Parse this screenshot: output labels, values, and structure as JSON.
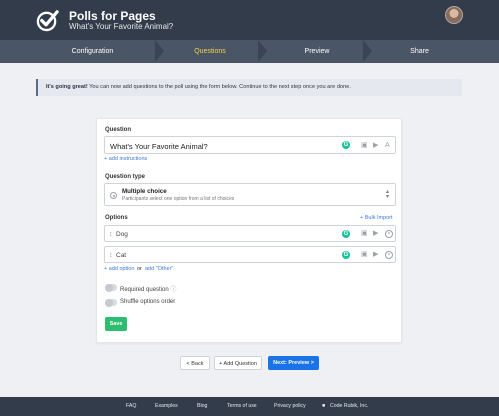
{
  "header": {
    "app_title": "Polls for Pages",
    "app_subtitle": "What's Your Favorite Animal?"
  },
  "steps": [
    {
      "label": "Configuration",
      "active": false
    },
    {
      "label": "Questions",
      "active": true
    },
    {
      "label": "Preview",
      "active": false
    },
    {
      "label": "Share",
      "active": false
    }
  ],
  "info": {
    "bold": "It's going great!",
    "text": " You can now add questions to the poll using the form below. Continue to the next step once you are done."
  },
  "form": {
    "question_label": "Question",
    "question_value": "What's Your Favorite Animal?",
    "add_instructions": "+ add instructions",
    "question_type_label": "Question type",
    "question_type_title": "Multiple choice",
    "question_type_desc": "Participants select one option from a list of choices",
    "options_label": "Options",
    "bulk_import": "+ Bulk Import",
    "options": [
      "Dog",
      "Cat"
    ],
    "add_option": "+ add option",
    "or_text": "or",
    "add_other": "add \"Other\"",
    "required_label": "Required question",
    "shuffle_label": "Shuffle options order",
    "save_label": "Save"
  },
  "nav": {
    "back_label": "< Back",
    "add_question_label": "+ Add Question",
    "next_label": "Next: Preview >"
  },
  "footer": {
    "links": [
      "FAQ",
      "Examples",
      "Blog",
      "Terms of use",
      "Privacy policy"
    ],
    "company": "Code Rubik, Inc."
  },
  "colors": {
    "header_bg": "#333c4a",
    "active_step": "#f0d24a",
    "primary": "#1a73e8",
    "save": "#2dbd6e",
    "link": "#3b7bd8"
  }
}
